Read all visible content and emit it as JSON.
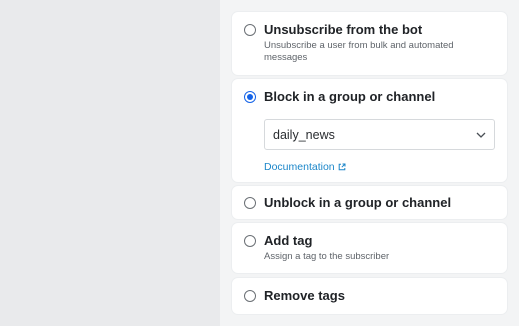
{
  "options": [
    {
      "title": "Unsubscribe from the bot",
      "description": "Unsubscribe a user from bulk and automated messages",
      "selected": false
    },
    {
      "title": "Block in a group or channel",
      "selected": true,
      "select_value": "daily_news",
      "link_label": "Documentation"
    },
    {
      "title": "Unblock in a group or channel",
      "selected": false
    },
    {
      "title": "Add tag",
      "description": "Assign a tag to the subscriber",
      "selected": false
    },
    {
      "title": "Remove tags",
      "selected": false
    }
  ],
  "colors": {
    "accent": "#1463e8",
    "link": "#1b86c9"
  }
}
